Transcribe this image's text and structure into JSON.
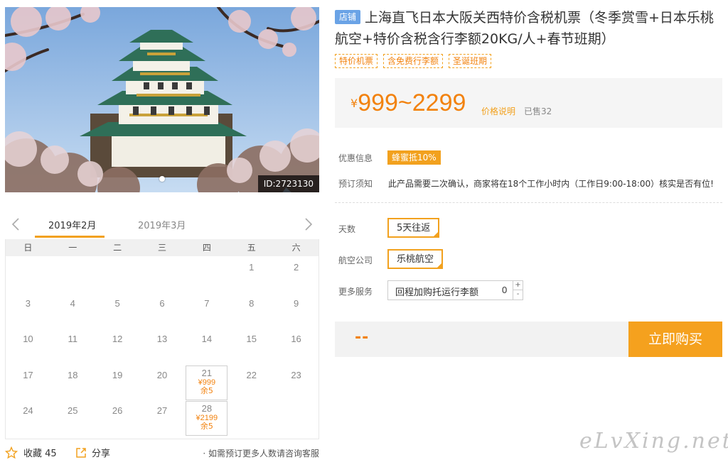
{
  "photo": {
    "id_label": "ID:2723130"
  },
  "calendar": {
    "months": [
      "2019年2月",
      "2019年3月"
    ],
    "weekdays": [
      "日",
      "一",
      "二",
      "三",
      "四",
      "五",
      "六"
    ],
    "days": [
      {
        "d": ""
      },
      {
        "d": ""
      },
      {
        "d": ""
      },
      {
        "d": ""
      },
      {
        "d": ""
      },
      {
        "d": "1"
      },
      {
        "d": "2"
      },
      {
        "d": "3"
      },
      {
        "d": "4"
      },
      {
        "d": "5"
      },
      {
        "d": "6"
      },
      {
        "d": "7"
      },
      {
        "d": "8"
      },
      {
        "d": "9"
      },
      {
        "d": "10"
      },
      {
        "d": "11"
      },
      {
        "d": "12"
      },
      {
        "d": "13"
      },
      {
        "d": "14"
      },
      {
        "d": "15"
      },
      {
        "d": "16"
      },
      {
        "d": "17"
      },
      {
        "d": "18"
      },
      {
        "d": "19"
      },
      {
        "d": "20"
      },
      {
        "d": "21",
        "price": "¥999",
        "stock": "余5"
      },
      {
        "d": "22"
      },
      {
        "d": "23"
      },
      {
        "d": "24"
      },
      {
        "d": "25"
      },
      {
        "d": "26"
      },
      {
        "d": "27"
      },
      {
        "d": "28",
        "price": "¥2199",
        "stock": "余5"
      }
    ]
  },
  "footer": {
    "fav_label": "收藏 45",
    "share_label": "分享",
    "consult_text": "· 如需预订更多人数请咨询客服"
  },
  "product": {
    "badge": "店铺",
    "title": "上海直飞日本大阪关西特价含税机票（冬季赏雪+日本乐桃航空+特价含税含行李额20KG/人+春节班期）",
    "tags": [
      "特价机票",
      "含免费行李额",
      "圣诞班期"
    ]
  },
  "price": {
    "currency": "¥",
    "range": "999~2299",
    "note": "价格说明",
    "sold": "已售32"
  },
  "info": {
    "promo_label": "优惠信息",
    "promo_value": "蜂蜜抵10%",
    "notice_label": "预订须知",
    "notice_text": "此产品需要二次确认，商家将在18个工作小时内（工作日9:00-18:00）核实是否有位!"
  },
  "options": {
    "days_label": "天数",
    "days_value": "5天往返",
    "airline_label": "航空公司",
    "airline_value": "乐桃航空",
    "service_label": "更多服务",
    "service_name": "回程加购托运行李额",
    "service_qty": "0",
    "plus": "+",
    "minus": "-"
  },
  "purchase": {
    "total": "--",
    "buy_label": "立即购买"
  },
  "watermark": "eLvXing.net",
  "colors": {
    "accent": "#f2a11e",
    "price": "#f2820e",
    "badge_blue": "#6aa3e6"
  }
}
